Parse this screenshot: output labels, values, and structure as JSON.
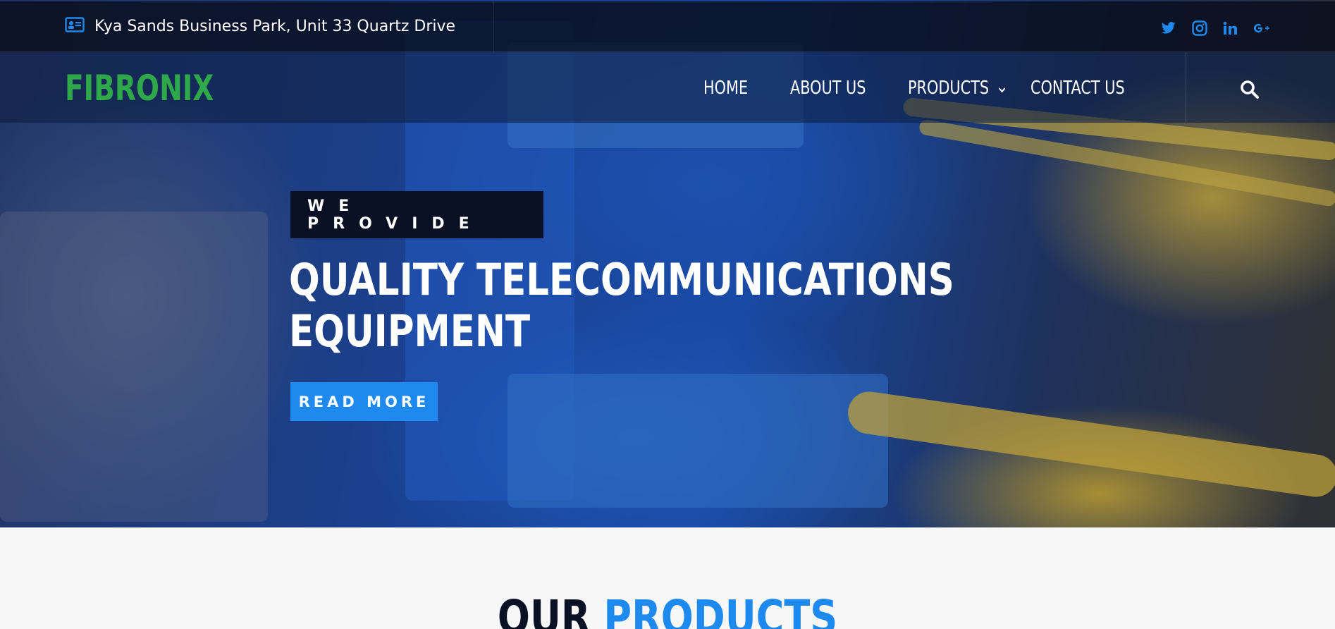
{
  "topbar": {
    "address": "Kya Sands Business Park, Unit 33 Quartz Drive",
    "address_icon": "address-card-icon",
    "social": [
      "twitter-icon",
      "instagram-icon",
      "linkedin-icon",
      "google-plus-icon"
    ]
  },
  "nav": {
    "logo": "FIBRONIX",
    "items": [
      {
        "label": "HOME"
      },
      {
        "label": "ABOUT US"
      },
      {
        "label": "PRODUCTS",
        "has_dropdown": true
      },
      {
        "label": "CONTACT US"
      }
    ],
    "search_icon": "search-icon"
  },
  "hero": {
    "eyebrow": "WE PROVIDE",
    "title_line1": "QUALITY TELECOMMUNICATIONS",
    "title_line2": "EQUIPMENT",
    "button": "READ MORE"
  },
  "section": {
    "heading_dark": "OUR",
    "heading_accent": "PRODUCTS"
  },
  "colors": {
    "brand_green": "#2fa84a",
    "accent_blue": "#1e8af0",
    "dark_navy": "#0b1124"
  }
}
